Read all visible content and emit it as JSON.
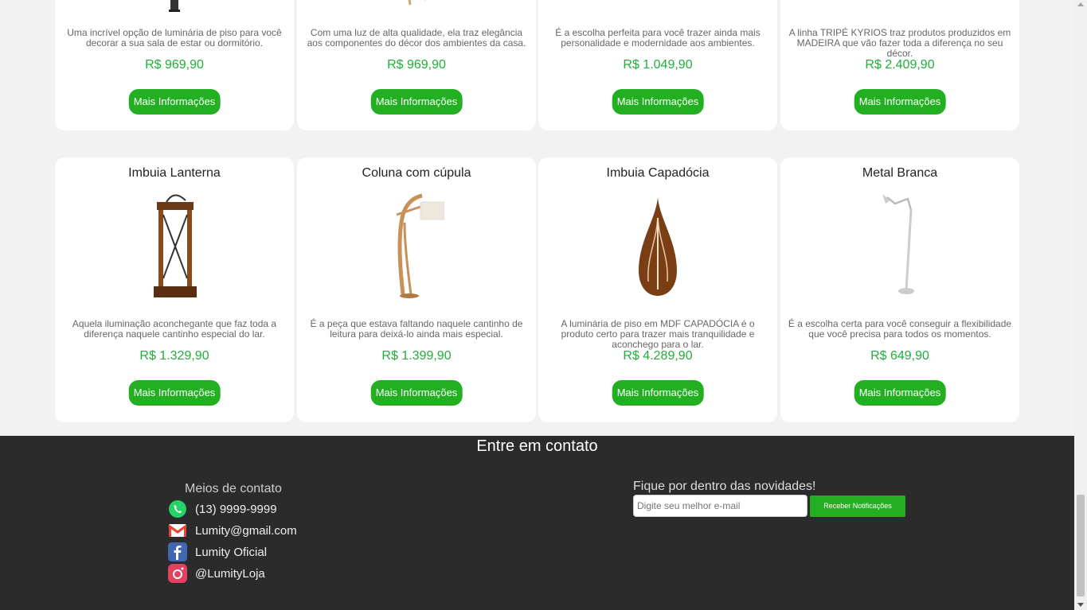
{
  "top_row": [
    {
      "desc": "Uma incrível opção de luminária de piso para você decorar a sua sala de estar ou dormitório.",
      "price": "R$ 969,90",
      "button": "Mais Informações"
    },
    {
      "desc": "Com uma luz de alta qualidade, ela traz elegância aos componentes do décor dos ambientes da casa.",
      "price": "R$ 969,90",
      "button": "Mais Informações"
    },
    {
      "desc": "É a escolha perfeita para você trazer ainda mais personalidade e modernidade aos ambientes.",
      "price": "R$ 1.049,90",
      "button": "Mais Informações"
    },
    {
      "desc": "A linha TRIPÉ KYRIOS traz produtos produzidos em MADEIRA que vão fazer toda a diferença no seu décor.",
      "price": "R$ 2.409,90",
      "button": "Mais Informações"
    }
  ],
  "bottom_row": [
    {
      "title": "Imbuia Lanterna",
      "desc": "Aquela iluminação aconchegante que faz toda a diferença naquele cantinho especial do lar.",
      "price": "R$ 1.329,90",
      "button": "Mais Informações",
      "icon": "lantern-lamp-image"
    },
    {
      "title": "Coluna com cúpula",
      "desc": "É a peça que estava faltando naquele cantinho de leitura para deixá-lo ainda mais especial.",
      "price": "R$ 1.399,90",
      "button": "Mais Informações",
      "icon": "arched-floor-lamp-image"
    },
    {
      "title": "Imbuia Capadócia",
      "desc": "A luminária de piso em MDF CAPADÓCIA é o produto certo para trazer mais tranquilidade e aconchego para o lar.",
      "price": "R$ 4.289,90",
      "button": "Mais Informações",
      "icon": "teardrop-lamp-image"
    },
    {
      "title": "Metal Branca",
      "desc": "É a escolha certa para você conseguir a flexibilidade que você precisa para todos os momentos.",
      "price": "R$ 649,90",
      "button": "Mais Informações",
      "icon": "white-metal-lamp-image"
    }
  ],
  "footer": {
    "heading": "Entre em contato",
    "contact_title": "Meios de contato",
    "contacts": [
      {
        "icon": "whatsapp-icon",
        "text": "(13) 9999-9999"
      },
      {
        "icon": "gmail-icon",
        "text": "Lumity@gmail.com"
      },
      {
        "icon": "facebook-icon",
        "text": "Lumity Oficial"
      },
      {
        "icon": "instagram-icon",
        "text": "@LumityLoja"
      }
    ],
    "newsletter_title": "Fique por dentro das novidades!",
    "email_placeholder": "Digite seu melhor e-mail",
    "notify_button": "Receber Notificações"
  },
  "colors": {
    "accent": "#22b022",
    "price": "#1fae3b",
    "footer_bg": "#2b2b2b"
  }
}
